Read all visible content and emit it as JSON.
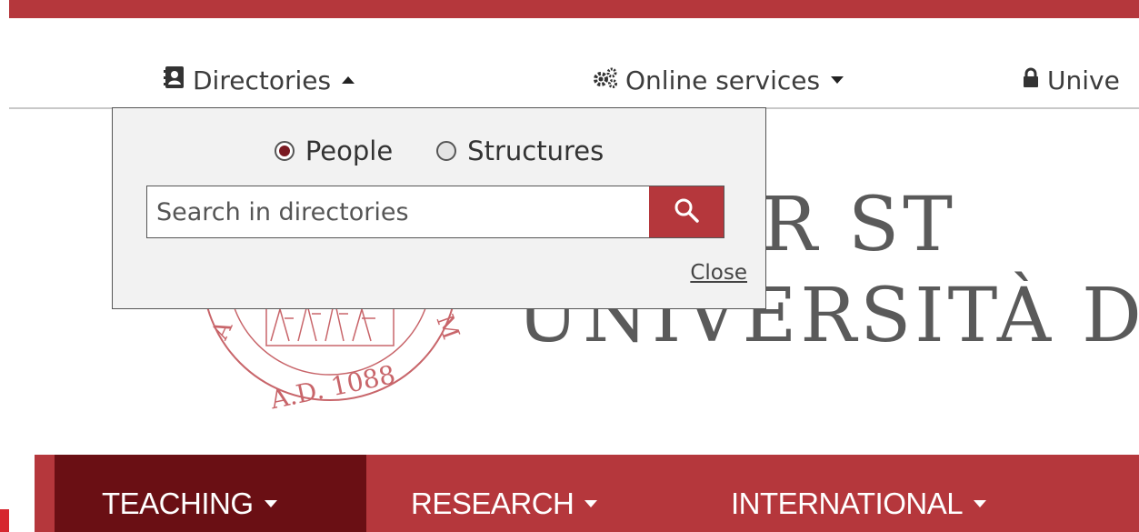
{
  "utility_bar": {
    "items": [
      {
        "label": "Directories",
        "icon": "address-book-icon",
        "state": "open"
      },
      {
        "label": "Online services",
        "icon": "gears-icon",
        "state": "closed"
      },
      {
        "label": "Unive",
        "icon": "lock-icon",
        "state": "truncated"
      }
    ]
  },
  "directories_panel": {
    "radio_options": [
      {
        "label": "People",
        "checked": true
      },
      {
        "label": "Structures",
        "checked": false
      }
    ],
    "search": {
      "placeholder": "Search in directories",
      "value": "",
      "button_icon": "search-icon"
    },
    "close_label": "Close"
  },
  "header": {
    "title_line1": "MATER ST",
    "title_line2": "UNIVERSITÀ DI I",
    "seal_text": "A.D. 1088",
    "seal_letters": [
      "A",
      "M"
    ]
  },
  "main_nav": {
    "items": [
      {
        "label": "TEACHING",
        "active": true
      },
      {
        "label": "RESEARCH",
        "active": false
      },
      {
        "label": "INTERNATIONAL",
        "active": false
      }
    ]
  },
  "colors": {
    "brand_red": "#b5373c",
    "active_nav": "#6a0f14",
    "radio_checked": "#7a1a22"
  }
}
